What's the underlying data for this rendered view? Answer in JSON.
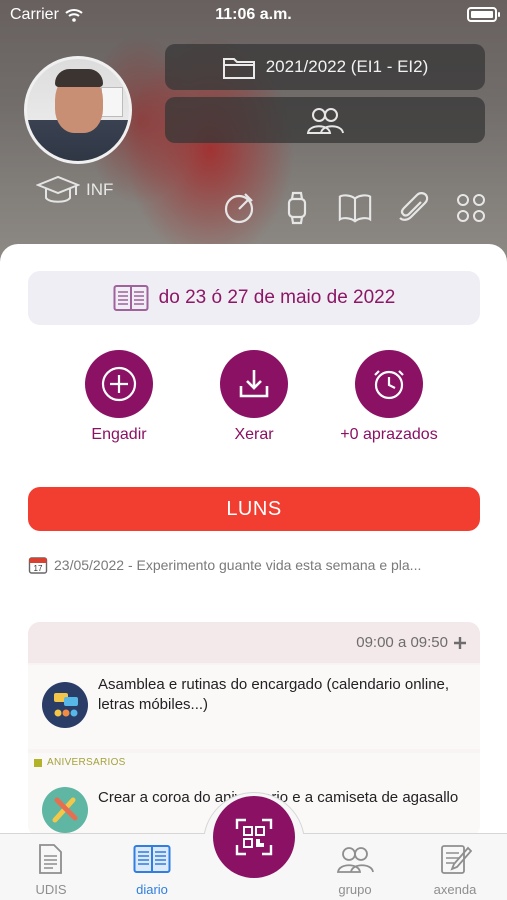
{
  "status_bar": {
    "carrier": "Carrier",
    "time": "11:06 a.m."
  },
  "header": {
    "course": "2021/2022 (EI1 - EI2)",
    "level": "INF"
  },
  "week_label": "do 23 ó 27 de maio de 2022",
  "actions": [
    {
      "label": "Engadir",
      "icon": "plus-icon"
    },
    {
      "label": "Xerar",
      "icon": "download-icon"
    },
    {
      "label": "+0 aprazados",
      "icon": "clock-icon"
    }
  ],
  "day": "LUNS",
  "note": {
    "text": "23/05/2022 - Experimento guante vida esta semana e pla..."
  },
  "session": {
    "time": "09:00 a 09:50",
    "activities": [
      {
        "text": "Asamblea e rutinas do encargado (calendario online, letras móbiles...)",
        "tag": ""
      },
      {
        "text": "Crear a coroa do aniversario e a camiseta de agasallo",
        "tag": "ANIVERSARIOS"
      }
    ]
  },
  "tabs": [
    {
      "label": "UDIS",
      "icon": "document-icon"
    },
    {
      "label": "diario",
      "icon": "book-icon",
      "active": true
    },
    {
      "label": "grupo",
      "icon": "group-icon"
    },
    {
      "label": "axenda",
      "icon": "notepad-icon"
    }
  ],
  "colors": {
    "brand": "#8a1164",
    "day_bar": "#f23d31",
    "active_tab": "#2f7ee0"
  }
}
